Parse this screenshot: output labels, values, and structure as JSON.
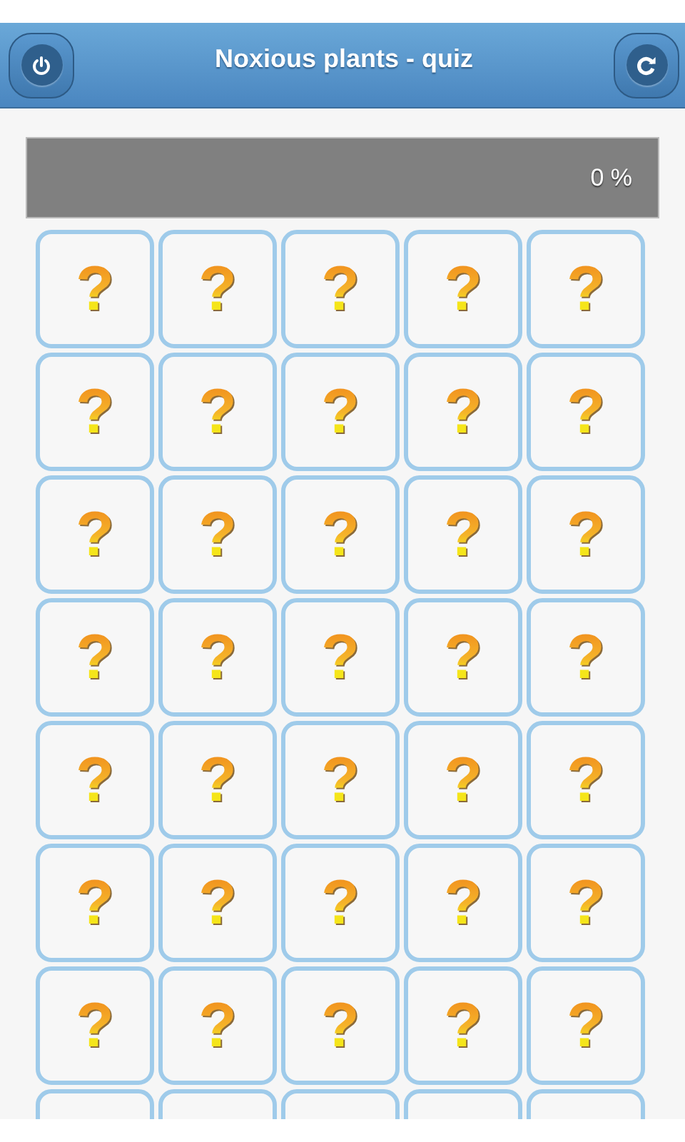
{
  "header": {
    "title": "Noxious plants - quiz",
    "left_button": {
      "kind": "power"
    },
    "right_button": {
      "kind": "refresh"
    }
  },
  "progress": {
    "level": 0,
    "reading": "0 %"
  },
  "cards": [
    {
      "kind": "question",
      "symbol": "?"
    },
    {
      "kind": "question",
      "symbol": "?"
    },
    {
      "kind": "question",
      "symbol": "?"
    },
    {
      "kind": "question",
      "symbol": "?"
    },
    {
      "kind": "question",
      "symbol": "?"
    },
    {
      "kind": "question",
      "symbol": "?"
    },
    {
      "kind": "question",
      "symbol": "?"
    },
    {
      "kind": "question",
      "symbol": "?"
    },
    {
      "kind": "question",
      "symbol": "?"
    },
    {
      "kind": "question",
      "symbol": "?"
    },
    {
      "kind": "question",
      "symbol": "?"
    },
    {
      "kind": "question",
      "symbol": "?"
    },
    {
      "kind": "question",
      "symbol": "?"
    },
    {
      "kind": "question",
      "symbol": "?"
    },
    {
      "kind": "question",
      "symbol": "?"
    },
    {
      "kind": "question",
      "symbol": "?"
    },
    {
      "kind": "question",
      "symbol": "?"
    },
    {
      "kind": "question",
      "symbol": "?"
    },
    {
      "kind": "question",
      "symbol": "?"
    },
    {
      "kind": "question",
      "symbol": "?"
    },
    {
      "kind": "question",
      "symbol": "?"
    },
    {
      "kind": "question",
      "symbol": "?"
    },
    {
      "kind": "question",
      "symbol": "?"
    },
    {
      "kind": "question",
      "symbol": "?"
    },
    {
      "kind": "question",
      "symbol": "?"
    },
    {
      "kind": "question",
      "symbol": "?"
    },
    {
      "kind": "question",
      "symbol": "?"
    },
    {
      "kind": "question",
      "symbol": "?"
    },
    {
      "kind": "question",
      "symbol": "?"
    },
    {
      "kind": "question",
      "symbol": "?"
    },
    {
      "kind": "question",
      "symbol": "?"
    },
    {
      "kind": "question",
      "symbol": "?"
    },
    {
      "kind": "question",
      "symbol": "?"
    },
    {
      "kind": "question",
      "symbol": "?"
    },
    {
      "kind": "question",
      "symbol": "?"
    },
    {
      "kind": "hidden"
    },
    {
      "kind": "hidden"
    },
    {
      "kind": "hidden"
    },
    {
      "kind": "hidden"
    },
    {
      "kind": "hidden"
    }
  ]
}
